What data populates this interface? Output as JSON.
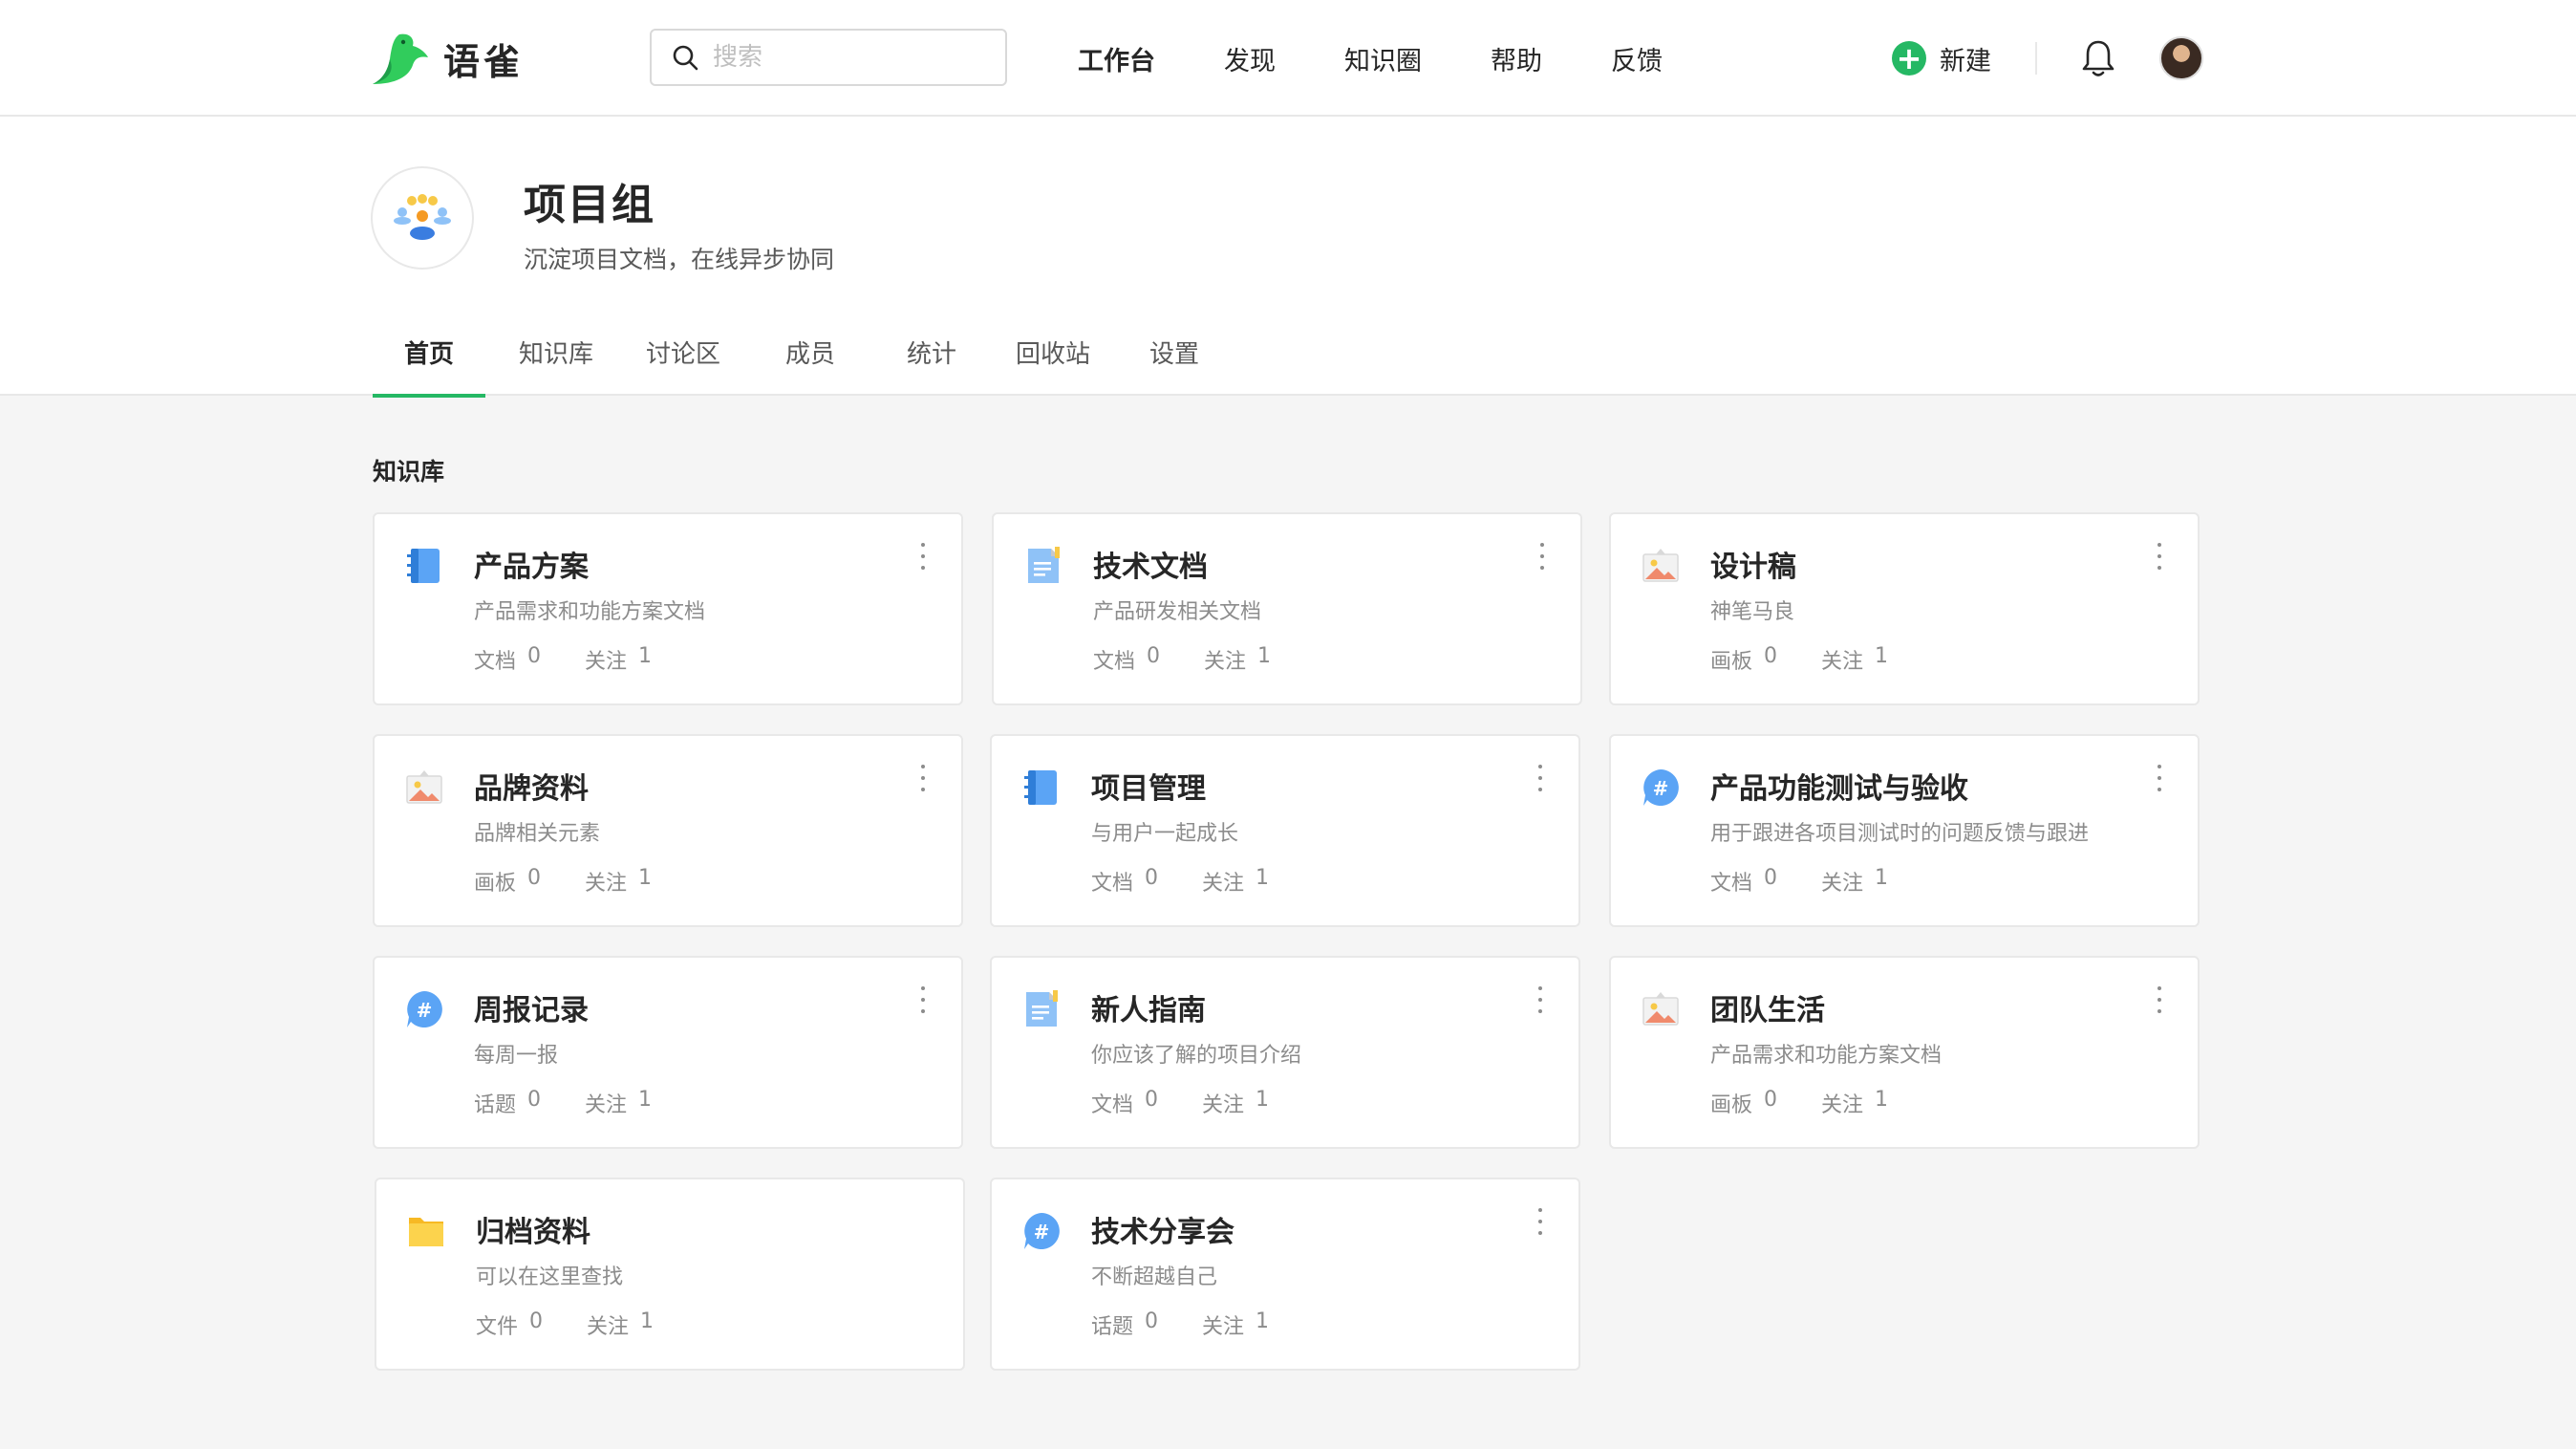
{
  "app": {
    "name": "语雀"
  },
  "search": {
    "placeholder": "搜索"
  },
  "topnav": [
    "工作台",
    "发现",
    "知识圈",
    "帮助",
    "反馈"
  ],
  "header": {
    "new_label": "新建"
  },
  "group": {
    "title": "项目组",
    "description": "沉淀项目文档，在线异步协同",
    "tabs": [
      "首页",
      "知识库",
      "讨论区",
      "成员",
      "统计",
      "回收站",
      "设置"
    ],
    "active_tab": "首页"
  },
  "section": {
    "title": "知识库"
  },
  "repos": [
    {
      "title": "产品方案",
      "desc": "产品需求和功能方案文档",
      "stat1_label": "文档",
      "stat1_value": "0",
      "stat2_label": "关注",
      "stat2_value": "1",
      "icon": "book-icon"
    },
    {
      "title": "技术文档",
      "desc": "产品研发相关文档",
      "stat1_label": "文档",
      "stat1_value": "0",
      "stat2_label": "关注",
      "stat2_value": "1",
      "icon": "doc-icon"
    },
    {
      "title": "设计稿",
      "desc": "神笔马良",
      "stat1_label": "画板",
      "stat1_value": "0",
      "stat2_label": "关注",
      "stat2_value": "1",
      "icon": "artboard-icon"
    },
    {
      "title": "品牌资料",
      "desc": "品牌相关元素",
      "stat1_label": "画板",
      "stat1_value": "0",
      "stat2_label": "关注",
      "stat2_value": "1",
      "icon": "artboard-icon"
    },
    {
      "title": "项目管理",
      "desc": "与用户一起成长",
      "stat1_label": "文档",
      "stat1_value": "0",
      "stat2_label": "关注",
      "stat2_value": "1",
      "icon": "book-icon"
    },
    {
      "title": "产品功能测试与验收",
      "desc": "用于跟进各项目测试时的问题反馈与跟进",
      "stat1_label": "文档",
      "stat1_value": "0",
      "stat2_label": "关注",
      "stat2_value": "1",
      "icon": "topic-icon"
    },
    {
      "title": "周报记录",
      "desc": "每周一报",
      "stat1_label": "话题",
      "stat1_value": "0",
      "stat2_label": "关注",
      "stat2_value": "1",
      "icon": "topic-icon"
    },
    {
      "title": "新人指南",
      "desc": "你应该了解的项目介绍",
      "stat1_label": "文档",
      "stat1_value": "0",
      "stat2_label": "关注",
      "stat2_value": "1",
      "icon": "doc-icon"
    },
    {
      "title": "团队生活",
      "desc": "产品需求和功能方案文档",
      "stat1_label": "画板",
      "stat1_value": "0",
      "stat2_label": "关注",
      "stat2_value": "1",
      "icon": "artboard-icon"
    },
    {
      "title": "归档资料",
      "desc": "可以在这里查找",
      "stat1_label": "文件",
      "stat1_value": "0",
      "stat2_label": "关注",
      "stat2_value": "1",
      "icon": "folder-icon"
    },
    {
      "title": "技术分享会",
      "desc": "不断超越自己",
      "stat1_label": "话题",
      "stat1_value": "0",
      "stat2_label": "关注",
      "stat2_value": "1",
      "icon": "topic-icon"
    }
  ],
  "colors": {
    "accent": "#25b864",
    "card_border": "#e8e8e8",
    "page_bg": "#f5f5f5"
  }
}
